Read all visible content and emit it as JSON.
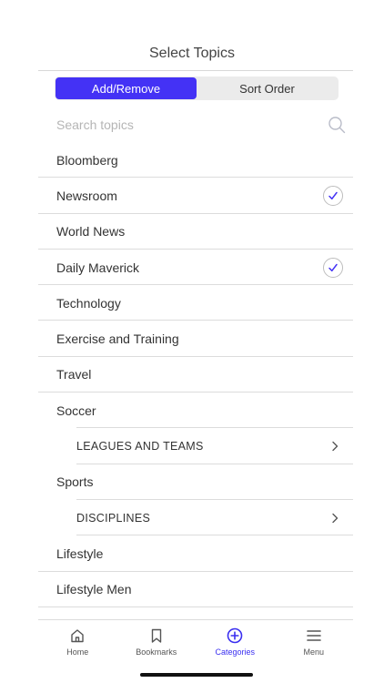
{
  "header": {
    "title": "Select Topics"
  },
  "segmented": {
    "add_remove": "Add/Remove",
    "sort_order": "Sort Order",
    "selected": "Add/Remove"
  },
  "search": {
    "placeholder": "Search topics",
    "value": ""
  },
  "topics": [
    {
      "label": "Bloomberg",
      "checked": false
    },
    {
      "label": "Newsroom",
      "checked": true
    },
    {
      "label": "World News",
      "checked": false
    },
    {
      "label": "Daily Maverick",
      "checked": true
    },
    {
      "label": "Technology",
      "checked": false
    },
    {
      "label": "Exercise and Training",
      "checked": false
    },
    {
      "label": "Travel",
      "checked": false
    },
    {
      "label": "Soccer",
      "checked": false
    },
    {
      "label": "LEAGUES AND TEAMS",
      "sub": true
    },
    {
      "label": "Sports",
      "checked": false
    },
    {
      "label": "DISCIPLINES",
      "sub": true
    },
    {
      "label": "Lifestyle",
      "checked": false
    },
    {
      "label": "Lifestyle Men",
      "checked": false
    }
  ],
  "tabbar": {
    "home": "Home",
    "bookmarks": "Bookmarks",
    "categories": "Categories",
    "menu": "Menu",
    "active": "categories"
  },
  "colors": {
    "accent": "#4432f5",
    "text": "#333333",
    "divider": "#dcdcdc"
  },
  "icons": {
    "search": "search-icon",
    "check": "check-icon",
    "chevron": "chevron-right-icon",
    "home": "home-icon",
    "bookmarks": "bookmark-icon",
    "categories": "plus-circle-icon",
    "menu": "menu-icon"
  }
}
